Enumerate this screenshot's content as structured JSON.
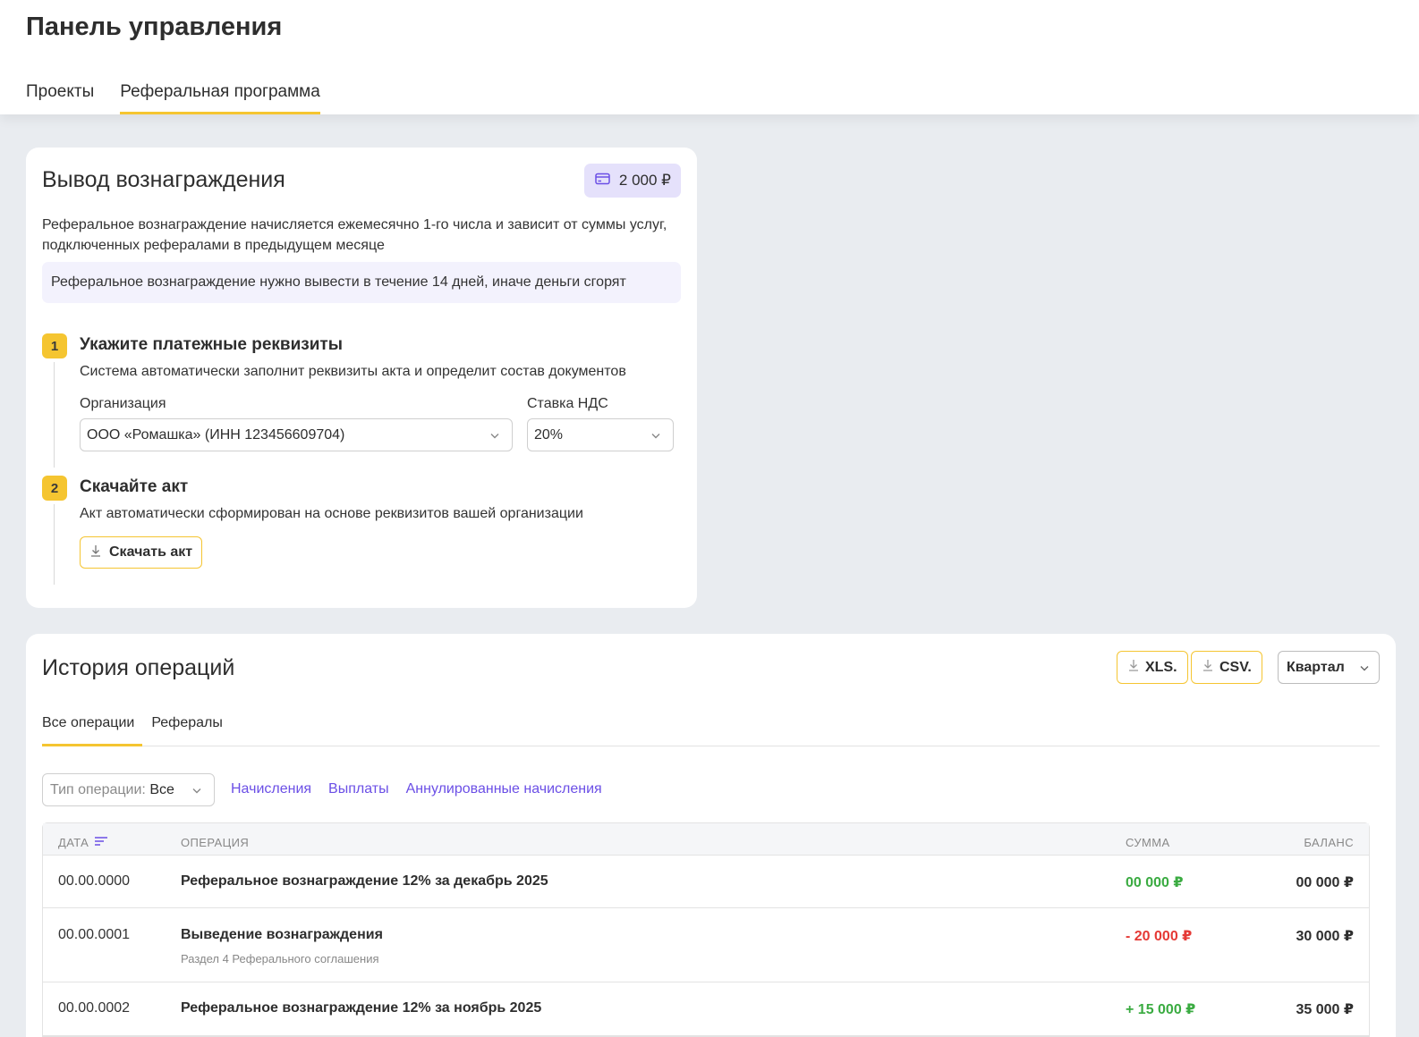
{
  "header": {
    "title": "Панель управления",
    "tabs": [
      {
        "label": "Проекты",
        "active": false
      },
      {
        "label": "Реферальная программа",
        "active": true
      }
    ]
  },
  "withdraw": {
    "title": "Вывод вознаграждения",
    "balance": "2 000 ₽",
    "balance_icon": "card-icon",
    "description": "Реферальное вознаграждение начисляется ежемесячно 1-го числа и зависит от суммы услуг, подключенных рефералами в предыдущем месяце",
    "notice": "Реферальное вознаграждение нужно вывести в течение 14 дней, иначе деньги сгорят",
    "step1": {
      "number": "1",
      "title": "Укажите платежные реквизиты",
      "subtitle": "Система автоматически заполнит реквизиты акта и определит состав документов",
      "org_label": "Организация",
      "org_value": "ООО «Ромашка» (ИНН 123456609704)",
      "vat_label": "Ставка НДС",
      "vat_value": "20%"
    },
    "step2": {
      "number": "2",
      "title": "Скачайте акт",
      "subtitle": "Акт автоматически сформирован на основе реквизитов вашей организации",
      "button": "Скачать акт"
    }
  },
  "history": {
    "title": "История операций",
    "export_xls": "XLS.",
    "export_csv": "CSV.",
    "period": "Квартал",
    "tabs": [
      {
        "label": "Все операции",
        "active": true
      },
      {
        "label": "Рефералы",
        "active": false
      }
    ],
    "filter": {
      "label": "Тип операции:",
      "value": "Все",
      "links": [
        "Начисления",
        "Выплаты",
        "Аннулированные начисления"
      ]
    },
    "columns": {
      "date": "ДАТА",
      "operation": "ОПЕРАЦИЯ",
      "sum": "СУММА",
      "balance": "БАЛАНС"
    },
    "rows": [
      {
        "date": "00.00.0000",
        "operation": "Реферальное вознаграждение 12% за декабрь 2025",
        "sub": "",
        "sum": "00 000 ₽",
        "sum_color": "#3aab41",
        "balance": "00 000 ₽"
      },
      {
        "date": "00.00.0001",
        "operation": "Выведение вознаграждения",
        "sub": "Раздел 4 Реферального соглашения",
        "sum": "- 20 000 ₽",
        "sum_color": "#e53935",
        "balance": "30 000 ₽"
      },
      {
        "date": "00.00.0002",
        "operation": "Реферальное вознаграждение 12% за ноябрь 2025",
        "sub": "",
        "sum": "+ 15 000 ₽",
        "sum_color": "#3aab41",
        "balance": "35 000 ₽"
      }
    ]
  },
  "colors": {
    "accent": "#f5c531",
    "link": "#6b4fe6",
    "positive": "#3aab41",
    "negative": "#e53935",
    "badge_bg": "#e5e1fb"
  }
}
